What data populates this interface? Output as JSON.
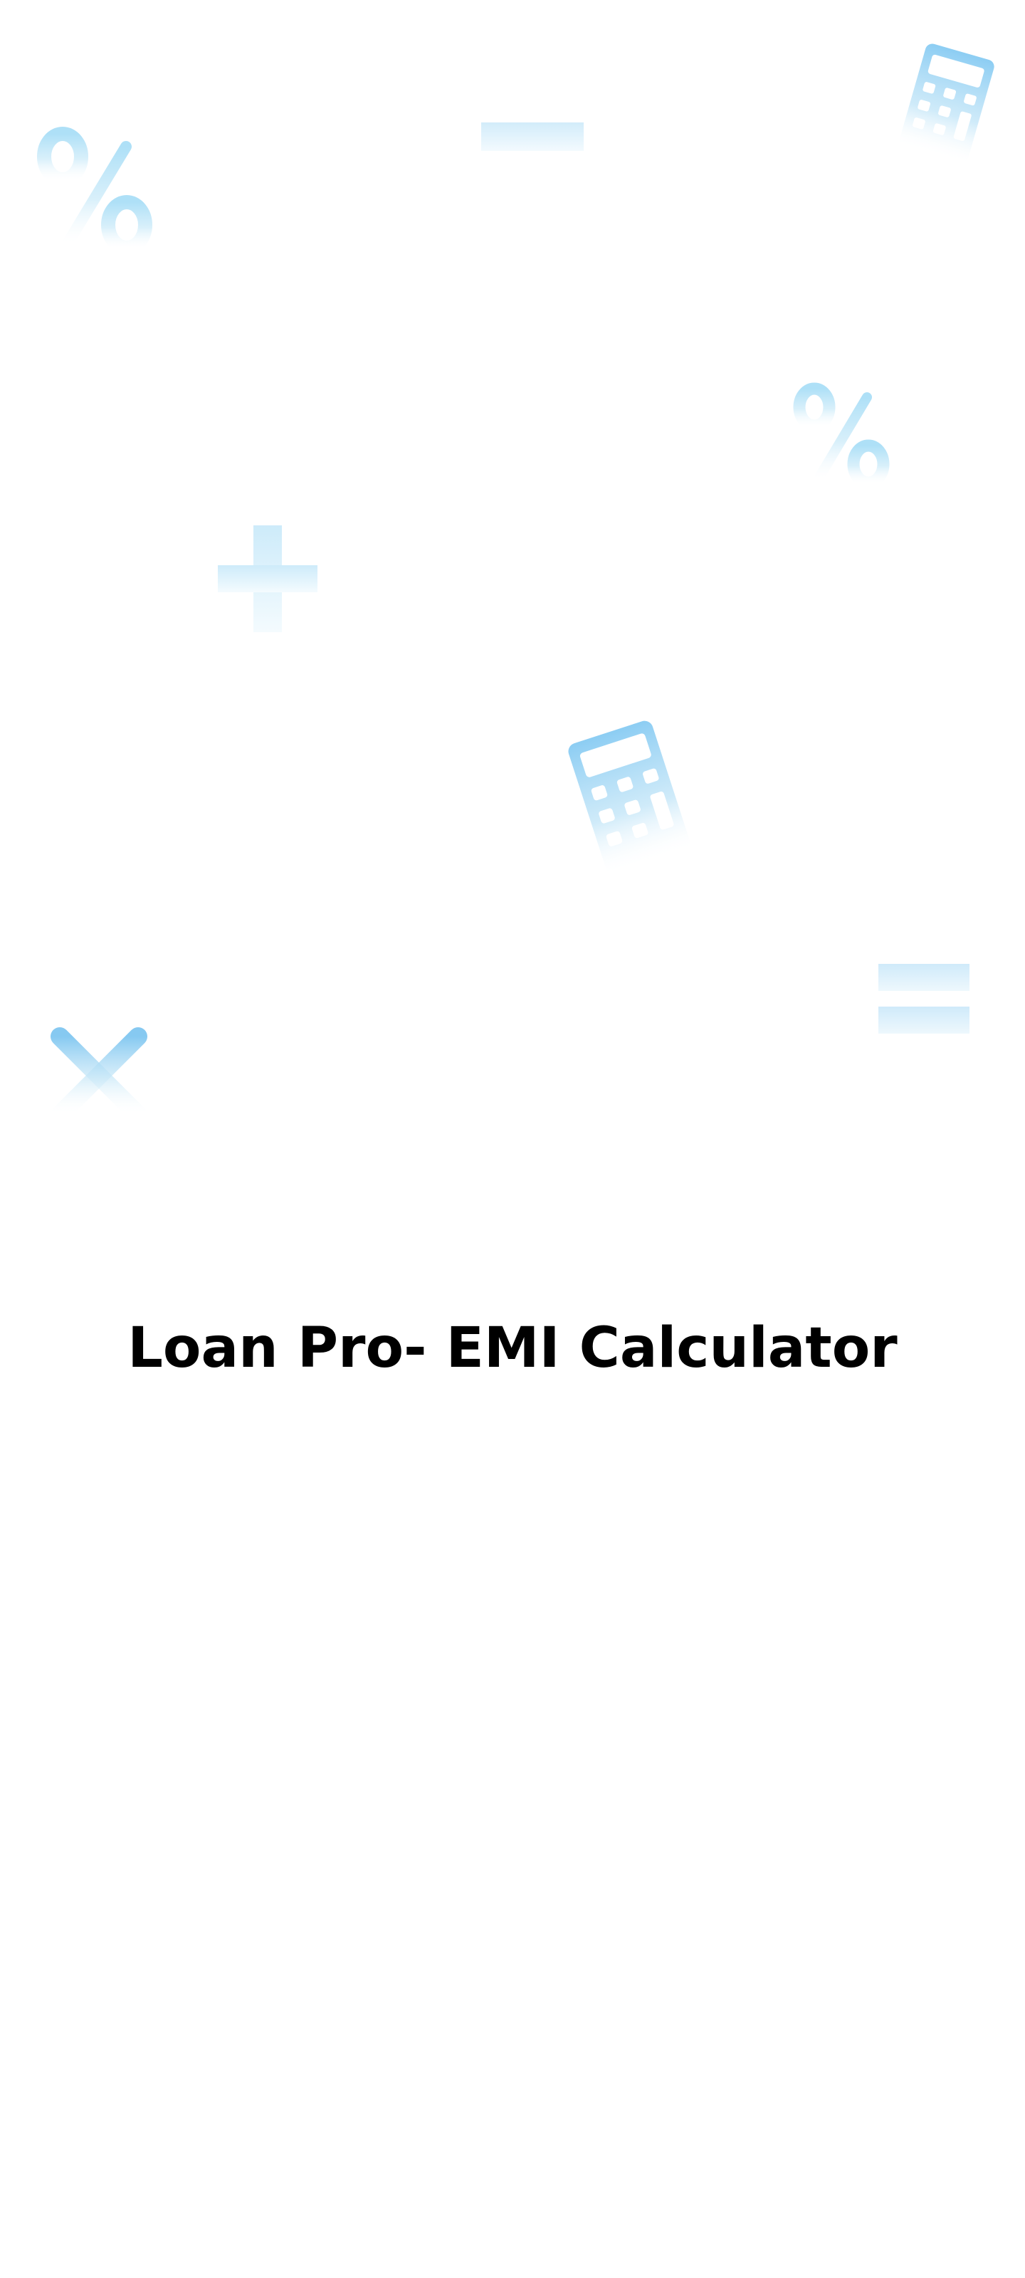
{
  "splash": {
    "title": "Loan Pro- EMI Calculator"
  },
  "colors": {
    "background": "#ffffff",
    "title_text": "#000000",
    "icon_strong": "#8cccf2",
    "icon_light": "#ddf0fa",
    "icon_fade": "#ffffff"
  },
  "decorative_icons": [
    "percent-icon",
    "minus-icon",
    "calculator-icon",
    "percent-icon",
    "plus-icon",
    "calculator-icon",
    "multiply-icon",
    "equals-icon"
  ]
}
